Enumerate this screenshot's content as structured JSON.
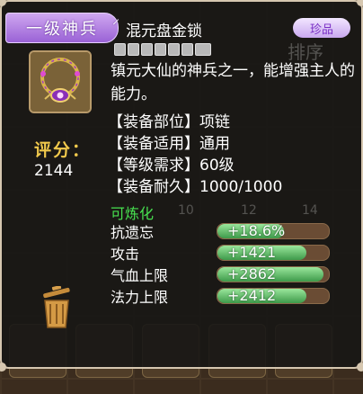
{
  "item": {
    "category_tag": "一级神兵",
    "name": "混元盘金锁",
    "rarity": "珍品",
    "description": "镇元大仙的神兵之一，能增强主人的能力。",
    "score_label": "评分：",
    "score_value": "2144",
    "attributes": [
      {
        "label": "【装备部位】",
        "value": "项链"
      },
      {
        "label": "【装备适用】",
        "value": "通用"
      },
      {
        "label": "【等级需求】",
        "value": "60级"
      },
      {
        "label": "【装备耐久】",
        "value": "1000/1000"
      }
    ],
    "refine_label": "可炼化",
    "stats": [
      {
        "name": "抗遗忘",
        "value": "+18.6%",
        "fill": 0.6
      },
      {
        "name": "攻击",
        "value": "+1421",
        "fill": 0.8
      },
      {
        "name": "气血上限",
        "value": "+2862",
        "fill": 0.95
      },
      {
        "name": "法力上限",
        "value": "+2412",
        "fill": 0.8
      }
    ]
  },
  "background": {
    "label_sort": "排序",
    "numbers": [
      "10",
      "12",
      "14"
    ]
  },
  "colors": {
    "tag": "#9a62d6",
    "refine": "#47e04f",
    "score_label": "#f1c94c",
    "stat_fill": "#3e9a4a"
  },
  "icons": [
    "necklace-item-icon",
    "trash-can-icon",
    "hook-icon"
  ]
}
